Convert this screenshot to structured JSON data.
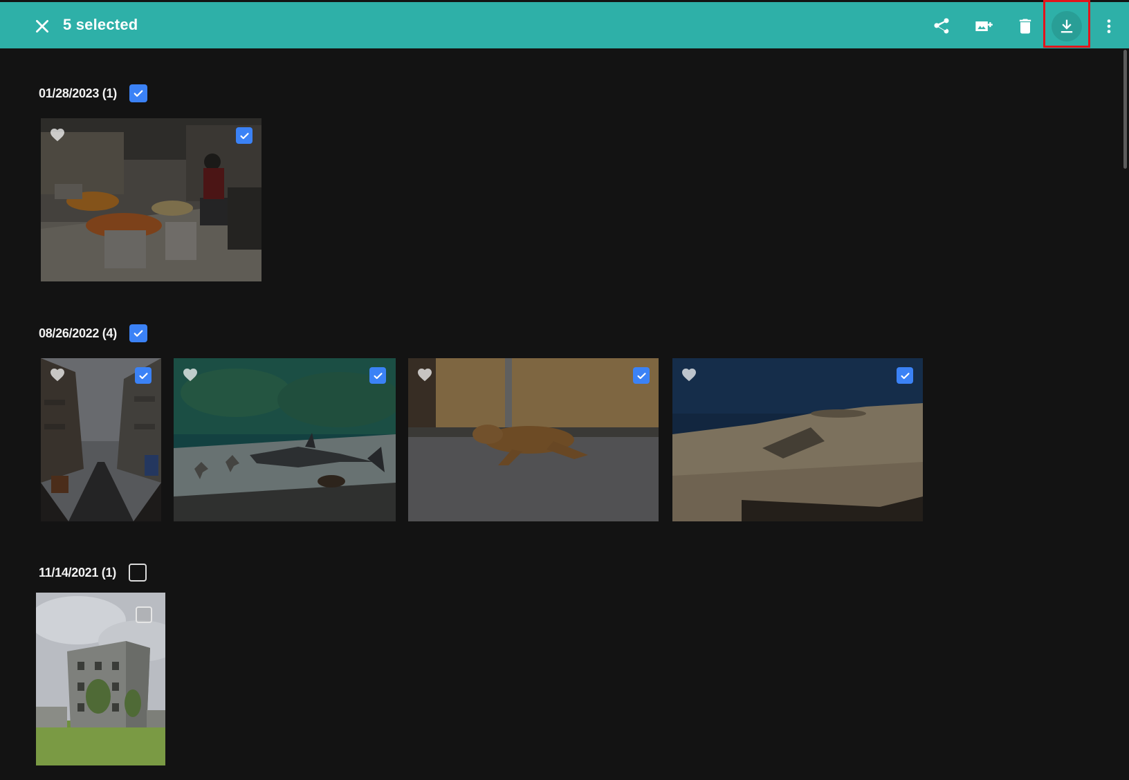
{
  "selection_bar": {
    "selected_label": "5 selected",
    "close_icon": "close-icon",
    "actions": [
      {
        "name": "share",
        "icon": "share-icon"
      },
      {
        "name": "add-to-album",
        "icon": "add-to-album-icon"
      },
      {
        "name": "delete",
        "icon": "trash-icon"
      },
      {
        "name": "download",
        "icon": "download-icon",
        "highlighted": true
      },
      {
        "name": "more",
        "icon": "more-vert-icon"
      }
    ],
    "color": "#2eb0a8"
  },
  "accent_color": "#3b82f6",
  "highlight_color": "#e3141b",
  "groups": [
    {
      "date_label": "01/28/2023 (1)",
      "selected": true,
      "photos": [
        {
          "subject": "market stall",
          "selected": true,
          "favorite_icon": "heart-icon"
        }
      ]
    },
    {
      "date_label": "08/26/2022 (4)",
      "selected": true,
      "photos": [
        {
          "subject": "street",
          "selected": true,
          "favorite_icon": "heart-icon"
        },
        {
          "subject": "shark aquarium",
          "selected": true,
          "favorite_icon": "heart-icon"
        },
        {
          "subject": "sleeping dog",
          "selected": true,
          "favorite_icon": "heart-icon"
        },
        {
          "subject": "coastal rock",
          "selected": true,
          "favorite_icon": "heart-icon"
        }
      ]
    },
    {
      "date_label": "11/14/2021 (1)",
      "selected": false,
      "photos": [
        {
          "subject": "old building",
          "selected": false
        }
      ]
    }
  ]
}
